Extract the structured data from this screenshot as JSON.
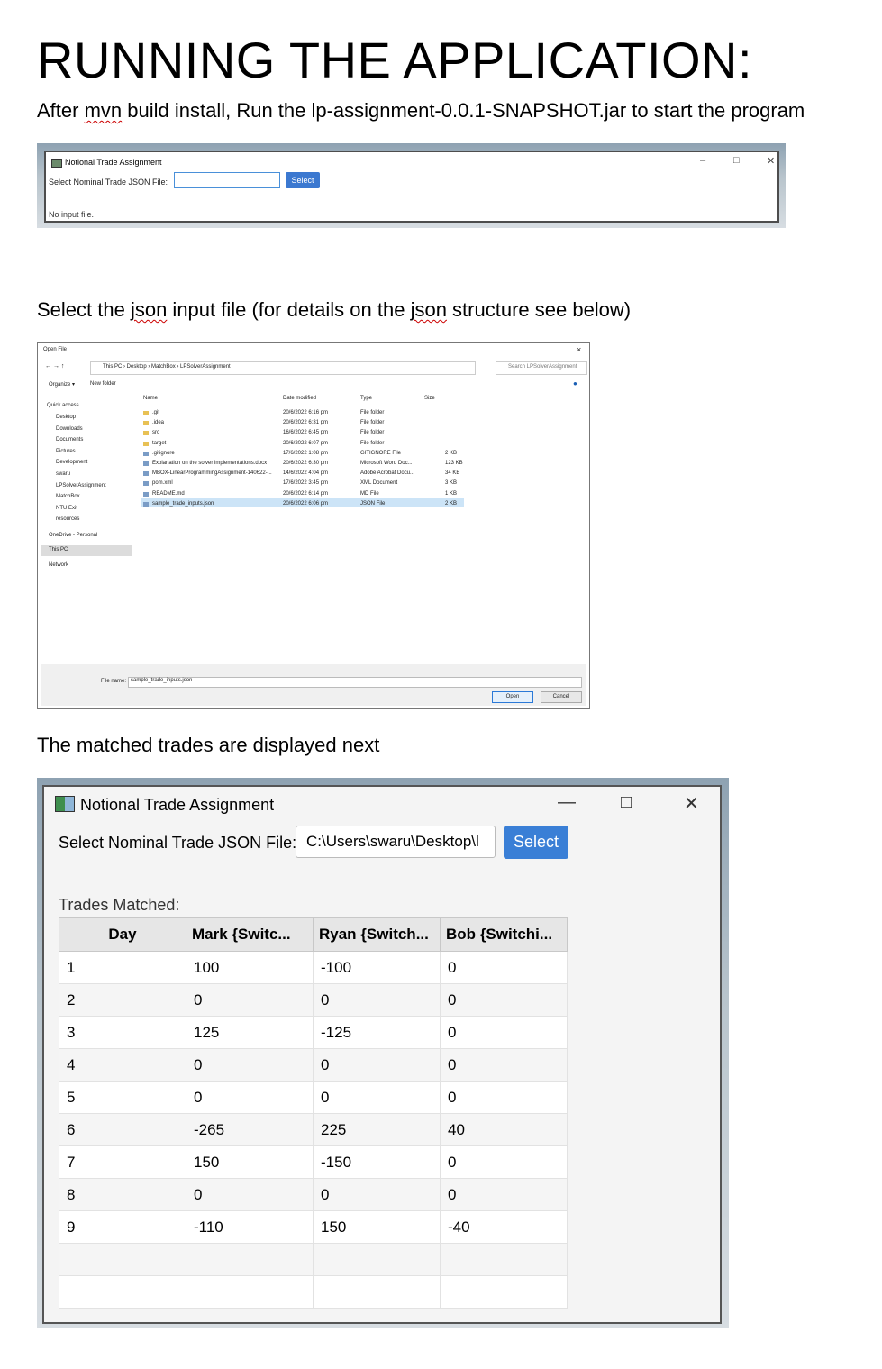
{
  "heading": "RUNNING THE APPLICATION:",
  "para1": {
    "before": "After ",
    "misspelled": "mvn",
    "after": " build install, Run the lp-assignment-0.0.1-SNAPSHOT.jar to start the program"
  },
  "para2": {
    "a": "Select the ",
    "b": "json",
    "c": " input file (for details on the ",
    "d": "json",
    "e": " structure see below)"
  },
  "para3": "The matched trades are displayed next",
  "window_small": {
    "title": "Notional Trade Assignment",
    "minimize": "–",
    "maximize": "□",
    "close": "✕",
    "field_label": "Select Nominal Trade JSON File:",
    "field_value": "",
    "select_label": "Select",
    "status": "No input file."
  },
  "open_dialog": {
    "title": "Open File",
    "close": "×",
    "path": "This PC  ›  Desktop  ›  MatchBox  ›  LPSolverAssignment",
    "search_placeholder": "Search LPSolverAssignment",
    "organize": "Organize ▾",
    "new_folder": "New folder",
    "columns": [
      "Name",
      "Date modified",
      "Type",
      "Size"
    ],
    "sidebar": [
      "Quick access",
      "Desktop",
      "Downloads",
      "Documents",
      "Pictures",
      "Development",
      "swaru",
      "LPSolverAssignment",
      "MatchBox",
      "NTU Exit",
      "resources",
      "OneDrive - Personal",
      "This PC",
      "Network"
    ],
    "files": [
      {
        "name": ".git",
        "date": "20/6/2022 6:16 pm",
        "type": "File folder",
        "size": ""
      },
      {
        "name": ".idea",
        "date": "20/6/2022 6:31 pm",
        "type": "File folder",
        "size": ""
      },
      {
        "name": "src",
        "date": "16/6/2022 6:45 pm",
        "type": "File folder",
        "size": ""
      },
      {
        "name": "target",
        "date": "20/6/2022 6:07 pm",
        "type": "File folder",
        "size": ""
      },
      {
        "name": ".gitignore",
        "date": "17/6/2022 1:08 pm",
        "type": "GITIGNORE File",
        "size": "2 KB"
      },
      {
        "name": "Explanation on the solver implementations.docx",
        "date": "20/6/2022 6:30 pm",
        "type": "Microsoft Word Doc...",
        "size": "123 KB"
      },
      {
        "name": "MBOX-LinearProgrammingAssignment-140622-...",
        "date": "14/6/2022 4:04 pm",
        "type": "Adobe Acrobat Docu...",
        "size": "34 KB"
      },
      {
        "name": "pom.xml",
        "date": "17/6/2022 3:45 pm",
        "type": "XML Document",
        "size": "3 KB"
      },
      {
        "name": "README.md",
        "date": "20/6/2022 6:14 pm",
        "type": "MD File",
        "size": "1 KB"
      },
      {
        "name": "sample_trade_inputs.json",
        "date": "20/6/2022 6:06 pm",
        "type": "JSON File",
        "size": "2 KB"
      }
    ],
    "filename_label": "File name:",
    "filename_value": "sample_trade_inputs.json",
    "open_label": "Open",
    "cancel_label": "Cancel"
  },
  "window_large": {
    "title": "Notional Trade Assignment",
    "minimize": "—",
    "maximize": "□",
    "close": "✕",
    "field_label": "Select Nominal Trade JSON File:",
    "field_value": "C:\\Users\\swaru\\Desktop\\l",
    "select_label": "Select",
    "matched_label": "Trades Matched:",
    "columns": [
      "Day",
      "Mark {Switc...",
      "Ryan {Switch...",
      "Bob {Switchi..."
    ],
    "rows": [
      [
        "1",
        "100",
        "-100",
        "0"
      ],
      [
        "2",
        "0",
        "0",
        "0"
      ],
      [
        "3",
        "125",
        "-125",
        "0"
      ],
      [
        "4",
        "0",
        "0",
        "0"
      ],
      [
        "5",
        "0",
        "0",
        "0"
      ],
      [
        "6",
        "-265",
        "225",
        "40"
      ],
      [
        "7",
        "150",
        "-150",
        "0"
      ],
      [
        "8",
        "0",
        "0",
        "0"
      ],
      [
        "9",
        "-110",
        "150",
        "-40"
      ]
    ]
  }
}
